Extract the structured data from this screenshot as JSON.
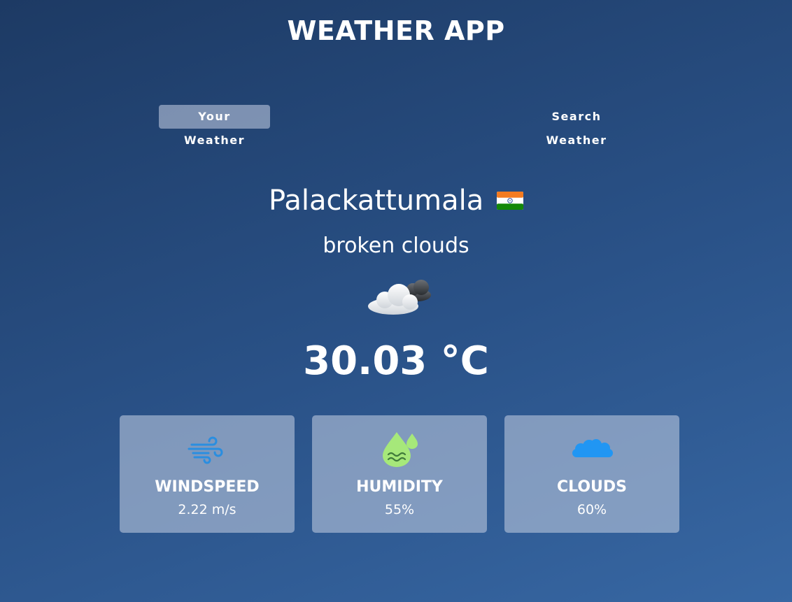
{
  "header": {
    "title": "WEATHER APP"
  },
  "tabs": [
    {
      "label": "Your Weather",
      "active": true
    },
    {
      "label": "Search Weather",
      "active": false
    }
  ],
  "location": {
    "city": "Palackattumala",
    "flag_icon": "india-flag-icon"
  },
  "weather": {
    "description": "broken clouds",
    "icon": "broken-clouds-icon",
    "temperature": "30.03 °C"
  },
  "stats": [
    {
      "label": "WINDSPEED",
      "value": "2.22 m/s",
      "icon": "wind-icon"
    },
    {
      "label": "HUMIDITY",
      "value": "55%",
      "icon": "humidity-icon"
    },
    {
      "label": "CLOUDS",
      "value": "60%",
      "icon": "cloud-icon"
    }
  ],
  "colors": {
    "background_top": "#1d3a64",
    "background_bottom": "#3767a3",
    "card_background": "#afbed7",
    "wind_icon": "#2a8ee0",
    "humidity_icon": "#a6e87a",
    "cloud_icon": "#2196f3"
  }
}
